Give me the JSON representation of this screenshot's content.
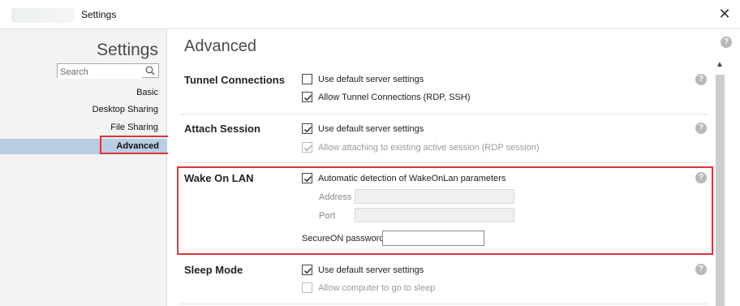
{
  "window": {
    "title": "Settings",
    "close_symbol": "✕"
  },
  "sidebar": {
    "title": "Settings",
    "search_placeholder": "Search",
    "items": [
      {
        "label": "Basic"
      },
      {
        "label": "Desktop Sharing"
      },
      {
        "label": "File Sharing"
      },
      {
        "label": "Advanced",
        "active": true
      }
    ]
  },
  "main": {
    "title": "Advanced",
    "sections": [
      {
        "label": "Tunnel Connections",
        "options": [
          {
            "label": "Use default server settings",
            "checked": false,
            "disabled": false
          },
          {
            "label": "Allow Tunnel Connections (RDP, SSH)",
            "checked": true,
            "disabled": false
          }
        ]
      },
      {
        "label": "Attach Session",
        "options": [
          {
            "label": "Use default server settings",
            "checked": true,
            "disabled": false
          },
          {
            "label": "Allow attaching to existing active session (RDP session)",
            "checked": true,
            "disabled": true
          }
        ]
      },
      {
        "label": "Wake On LAN",
        "options": [
          {
            "label": "Automatic detection of WakeOnLan parameters",
            "checked": true,
            "disabled": false
          }
        ],
        "fields": {
          "address_label": "Address",
          "address_value": "",
          "port_label": "Port",
          "port_value": "",
          "secure_label": "SecureON password",
          "secure_value": ""
        }
      },
      {
        "label": "Sleep Mode",
        "options": [
          {
            "label": "Use default server settings",
            "checked": true,
            "disabled": false
          },
          {
            "label": "Allow computer to go to sleep",
            "checked": false,
            "disabled": true
          }
        ]
      }
    ],
    "help_symbol": "?"
  },
  "colors": {
    "highlight": "#e0343a",
    "nav_active_bg": "#b9cde3",
    "sidebar_bg": "#f3f3f3",
    "help_icon": "#b8b8b8"
  },
  "icons": {
    "search": "search-icon",
    "help": "help-icon",
    "close": "close-icon",
    "checkmark": "checkmark-icon",
    "scroll_up": "chevron-up-icon"
  }
}
